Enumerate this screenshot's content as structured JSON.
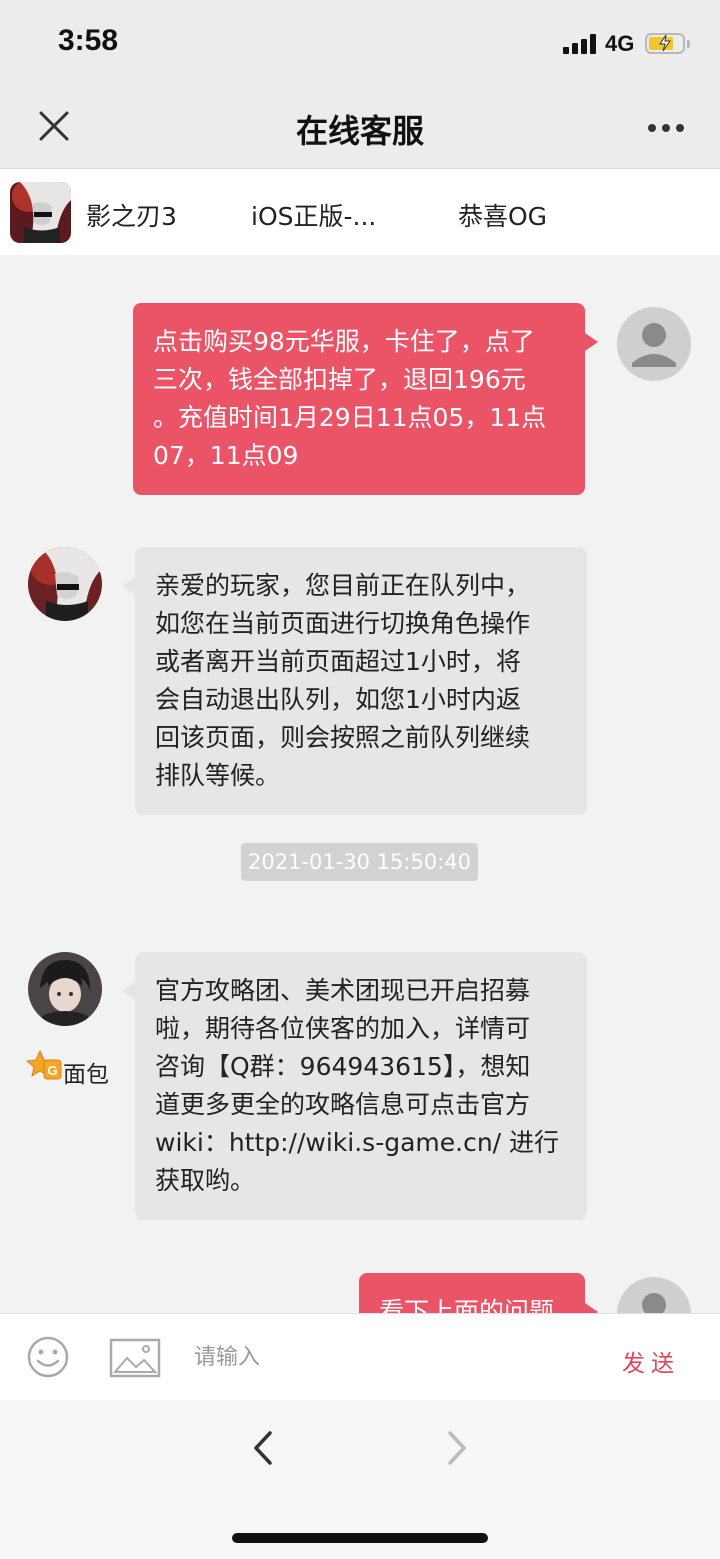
{
  "status_bar": {
    "time": "3:58",
    "network": "4G"
  },
  "nav": {
    "title": "在线客服"
  },
  "game_info": {
    "game_name": "影之刃3",
    "platform": "iOS正版-...",
    "server": "恭喜OG"
  },
  "messages": [
    {
      "sender": "user",
      "lines": [
        "点击购买98元华服，卡住了，点了",
        "三次，钱全部扣掉了，退回196元",
        "。充值时间1月29日11点05，11点",
        "07，11点09"
      ]
    },
    {
      "sender": "system",
      "lines": [
        "亲爱的玩家，您目前正在队列中，",
        "如您在当前页面进行切换角色操作",
        "或者离开当前页面超过1小时，将",
        "会自动退出队列，如您1小时内返",
        "回该页面，则会按照之前队列继续",
        "排队等候。"
      ]
    },
    {
      "sender": "agent",
      "agent_name": "面包",
      "badge_text": "G",
      "lines": [
        "官方攻略团、美术团现已开启招募",
        "啦，期待各位侠客的加入，详情可",
        "咨询【Q群：964943615】，想知",
        "道更多更全的攻略信息可点击官方",
        "wiki：http://wiki.s-game.cn/ 进行",
        "获取哟。"
      ]
    },
    {
      "sender": "user",
      "lines": [
        "看下上面的问题"
      ]
    }
  ],
  "timestamp": "2021-01-30 15:50:40",
  "input": {
    "placeholder": "请输入",
    "value": ""
  },
  "send_label": "发送",
  "colors": {
    "user_bubble": "#ea5466",
    "agent_bubble": "#e6e6e6",
    "send_text": "#e0455a"
  }
}
